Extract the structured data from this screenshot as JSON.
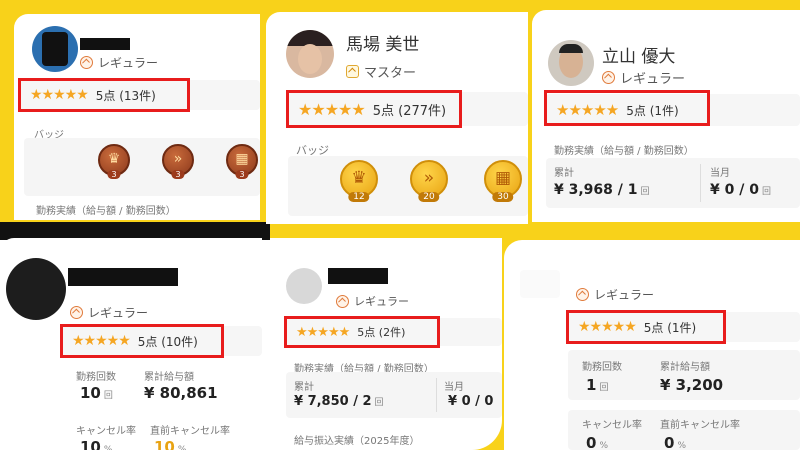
{
  "cards": [
    {
      "name": "",
      "rank": "レギュラー",
      "stars": "★★★★★",
      "rating": "5点 (13件)",
      "badges_label": "バッジ",
      "badges": [
        "3",
        "3",
        "3"
      ],
      "bottom_label": "勤務実績（給与額 / 勤務回数）"
    },
    {
      "name": "馬場 美世",
      "rank": "マスター",
      "stars": "★★★★★",
      "rating": "5点 (277件)",
      "badges_label": "バッジ",
      "badges": [
        "12",
        "20",
        "30"
      ]
    },
    {
      "name": "立山 優大",
      "rank": "レギュラー",
      "stars": "★★★★★",
      "rating": "5点 (1件)",
      "work_label": "勤務実績（給与額 / 勤務回数）",
      "total_label": "累計",
      "total_value": "¥ 3,968 / 1",
      "count_unit": "回",
      "month_label": "当月",
      "month_value": "¥ 0 / 0"
    },
    {
      "name": "",
      "rank": "レギュラー",
      "stars": "★★★★★",
      "rating": "5点 (10件)",
      "work_count_label": "勤務回数",
      "work_count_value": "10",
      "count_unit": "回",
      "pay_label": "累計給与額",
      "pay_value": "¥ 80,861",
      "cancel_label": "キャンセル率",
      "cancel_value": "10",
      "pct_unit": "%",
      "late_cancel_label": "直前キャンセル率",
      "late_cancel_value": "10"
    },
    {
      "name": "",
      "rank": "レギュラー",
      "stars": "★★★★★",
      "rating": "5点 (2件)",
      "work_label": "勤務実績（給与額 / 勤務回数）",
      "total_label": "累計",
      "total_value": "¥ 7,850 / 2",
      "count_unit": "回",
      "month_label": "当月",
      "month_value": "¥ 0 / 0",
      "transfer_label": "給与振込実績（2025年度）"
    },
    {
      "name": "",
      "rank": "レギュラー",
      "stars": "★★★★★",
      "rating": "5点 (1件)",
      "work_count_label": "勤務回数",
      "work_count_value": "1",
      "count_unit": "回",
      "pay_label": "累計給与額",
      "pay_value": "¥ 3,200",
      "cancel_label": "キャンセル率",
      "cancel_value": "0",
      "pct_unit": "%",
      "late_cancel_label": "直前キャンセル率",
      "late_cancel_value": "0"
    }
  ],
  "colors": {
    "brand_yellow": "#f8d21a",
    "star": "#f5a623",
    "highlight": "#e81c1c"
  }
}
